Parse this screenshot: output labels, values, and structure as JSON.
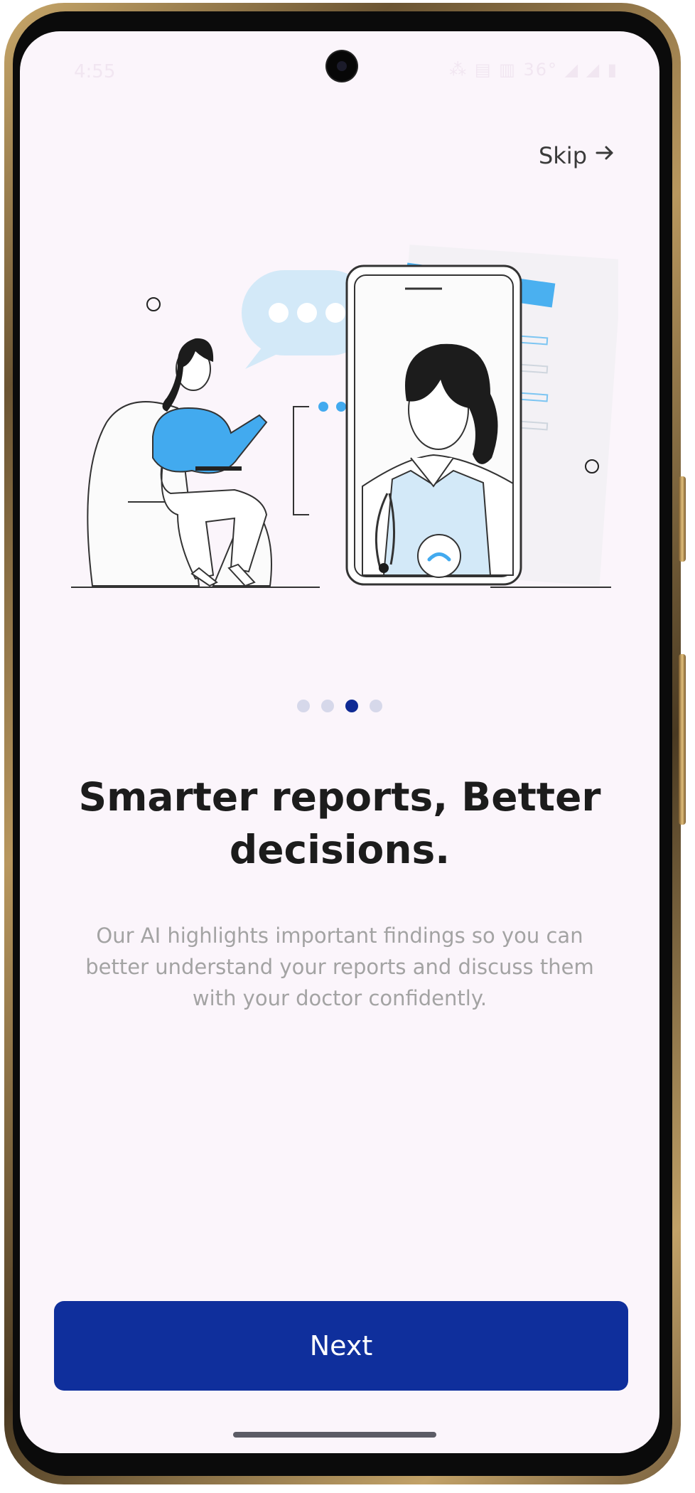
{
  "status_bar": {
    "time": "4:55",
    "right_icons": "⁂ ▤ ▥ 36° ◢ ◢ ▮"
  },
  "skip": {
    "label": "Skip",
    "icon": "arrow-right-icon"
  },
  "pagination": {
    "total": 4,
    "active_index": 2
  },
  "headline": "Smarter reports, Better decisions.",
  "body": "Our AI highlights important findings so you can better understand your reports and discuss them with your doctor confidently.",
  "next_button": {
    "label": "Next"
  },
  "colors": {
    "accent": "#0f2f9c",
    "illustration_blue": "#42aaef",
    "background": "#fbf5fb"
  }
}
